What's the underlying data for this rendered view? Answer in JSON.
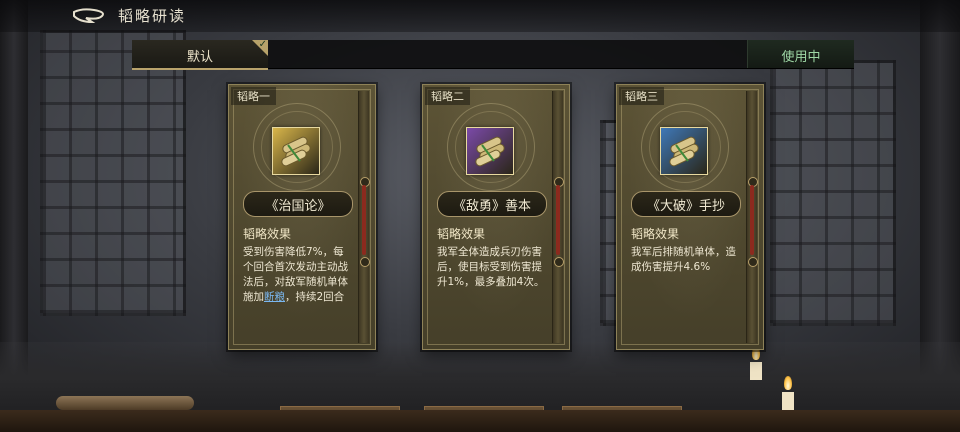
{
  "header": {
    "title": "韬略研读",
    "back_icon": "back-arrow-icon"
  },
  "tabs": {
    "default_label": "默认",
    "in_use_label": "使用中"
  },
  "cards": [
    {
      "number": "韬略一",
      "name": "《治国论》",
      "icon": "scroll-bundle-icon",
      "icon_bg": "#d9b64a",
      "effect_title": "韬略效果",
      "effect_pre": "受到伤害降低7%，每个回合首次发动主动战法后，对敌军随机单体施加",
      "effect_link": "断粮",
      "effect_post": "，持续2回合"
    },
    {
      "number": "韬略二",
      "name": "《敌勇》善本",
      "icon": "scroll-bundle-icon",
      "icon_bg": "#7b4aa8",
      "effect_title": "韬略效果",
      "effect_pre": "我军全体造成兵刃伤害后，使目标受到伤害提升1%，最多叠加4次。",
      "effect_link": "",
      "effect_post": ""
    },
    {
      "number": "韬略三",
      "name": "《大破》手抄",
      "icon": "scroll-bundle-icon",
      "icon_bg": "#3f78b8",
      "effect_title": "韬略效果",
      "effect_pre": "我军后排随机单体，造成伤害提升4.6%",
      "effect_link": "",
      "effect_post": ""
    }
  ],
  "colors": {
    "accent_gold": "#b9a36c",
    "in_use_green": "#9fd8a6",
    "link_blue": "#7ab7f0"
  }
}
